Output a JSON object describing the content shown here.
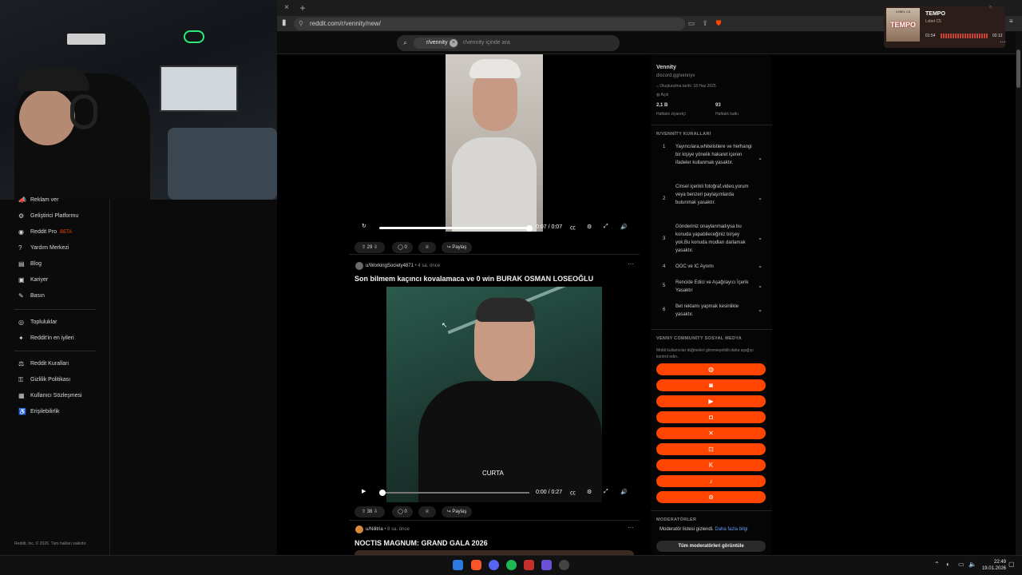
{
  "browser": {
    "url": "reddit.com/r/vennity/new/",
    "tab_close": "×",
    "new_tab": "+"
  },
  "search": {
    "chip": "r/vennity",
    "placeholder": "r/vennity içinde ara"
  },
  "left_nav": {
    "items": [
      {
        "label": "Reklam ver",
        "icon": "megaphone-icon"
      },
      {
        "label": "Geliştirici Platformu",
        "icon": "gear-icon"
      },
      {
        "label": "Reddit Pro",
        "icon": "pro-icon",
        "badge": "BETA"
      },
      {
        "label": "Yardım Merkezi",
        "icon": "help-icon"
      },
      {
        "label": "Blog",
        "icon": "blog-icon"
      },
      {
        "label": "Kariyer",
        "icon": "briefcase-icon"
      },
      {
        "label": "Basın",
        "icon": "press-icon"
      }
    ],
    "items2": [
      {
        "label": "Topluluklar",
        "icon": "communities-icon"
      },
      {
        "label": "Reddit'in en iyileri",
        "icon": "best-icon"
      }
    ],
    "items3": [
      {
        "label": "Reddit Kuralları",
        "icon": "rules-icon"
      },
      {
        "label": "Gizlilik Politikası",
        "icon": "privacy-icon"
      },
      {
        "label": "Kullanıcı Sözleşmesi",
        "icon": "agreement-icon"
      },
      {
        "label": "Erişilebilirlik",
        "icon": "accessibility-icon"
      }
    ],
    "copyright": "Reddit, Inc. © 2026. Tüm hakları saklıdır."
  },
  "posts": [
    {
      "time": "0:07 / 0:07",
      "upvotes": "29",
      "comments": "0",
      "share": "Paylaş"
    },
    {
      "author": "u/WorkingSociety4871",
      "age": "4 sa. önce",
      "title": "Son bilmem kaçıncı kovalamaca ve 0 win BURAK OSMAN LOSEOĞLU",
      "caption": "CURTA",
      "time": "0:00 / 0:27",
      "upvotes": "38",
      "comments": "0",
      "share": "Paylaş"
    },
    {
      "author": "u/Nilitria",
      "age": "8 sa. önce",
      "title": "NOCTIS MAGNUM: GRAND GALA 2026"
    }
  ],
  "sidebar": {
    "name": "Vennity",
    "link": "discord.gg/vennyv",
    "created": "Oluşturulma tarihi: 18 Haz 2025",
    "visibility": "Açık",
    "stat1_value": "2,1 B",
    "stat1_label": "Haftalık ziyaretçi",
    "stat2_value": "93",
    "stat2_label": "Haftalık katkı",
    "rules_title": "R/VENNİTY KURALLARI",
    "rules": [
      {
        "n": "1",
        "text": "Yayıncılara,whitelistlere ve herhangi bir kişiye yönelik hakaret içeren ifadeler kullanmak yasaktır."
      },
      {
        "n": "2",
        "text": "Cinsel içerikli fotoğraf,video,yorum veya benzeri paylaşımlarda bulunmak yasaktır."
      },
      {
        "n": "3",
        "text": "Gönderiniz onaylanmadıysa bu konuda yapabileceğiniz birşey yok.Bu konuda modları darlamak yasaktır."
      },
      {
        "n": "4",
        "text": "OOC ve IC Ayrımı"
      },
      {
        "n": "5",
        "text": "Rencide Edici ve Aşağılayıcı İçerik Yasaktır"
      },
      {
        "n": "6",
        "text": "Bet reklamı yapmak kesinlikle yasaktır."
      }
    ],
    "social_title": "VENNY COMMUNİTY SOSYAL MEDYA",
    "social_note": "Mobil kullanıcılar düğmeleri göremeyebilir,daha aşağıyı kontrol edin.",
    "socials": [
      "globe-icon",
      "discord-icon",
      "youtube-icon",
      "instagram-icon",
      "x-icon",
      "twitch-icon",
      "kick-icon",
      "tiktok-icon",
      "steam-icon"
    ],
    "mods_title": "MODERATÖRLER",
    "mods_hidden": "Moderatör listesi gizlendi.",
    "mods_more": "Daha fazla bilgi",
    "mods_button": "Tüm moderatörleri görüntüle"
  },
  "music": {
    "cover_text": "TEMPO",
    "cover_label": "LVBEL C5",
    "title": "TEMPO",
    "artist": "Lvbel C5",
    "current": "01:54",
    "total": "02:12"
  },
  "taskbar": {
    "time": "22:49",
    "date": "19.01.2026"
  },
  "colors": {
    "accent": "#ff4500",
    "background": "#0b0b0b"
  }
}
